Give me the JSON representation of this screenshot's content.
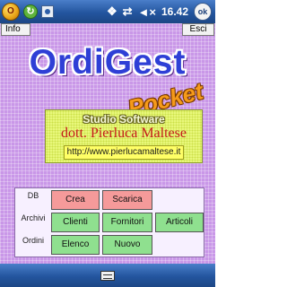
{
  "statusbar": {
    "icons": [
      "app-logo-icon",
      "sync-icon",
      "camera-icon",
      "start-windows-icon",
      "connectivity-icon",
      "volume-icon"
    ],
    "time": "16.42",
    "ok_label": "ok"
  },
  "top_buttons": {
    "info": "Info",
    "esci": "Esci"
  },
  "title": {
    "main": "OrdiGest",
    "sub": "Pocket"
  },
  "infobox": {
    "studio": "Studio Software",
    "author": "dott. Pierluca Maltese",
    "website": "http://www.pierlucamaltese.it"
  },
  "menu": {
    "labels": {
      "db": "DB",
      "archivi": "Archivi",
      "ordini": "Ordini"
    },
    "db_buttons": [
      "Crea",
      "Scarica"
    ],
    "archivi_buttons": [
      "Clienti",
      "Fornitori",
      "Articoli"
    ],
    "ordini_buttons": [
      "Elenco",
      "Nuovo"
    ]
  },
  "bottombar": {
    "icon": "keyboard-icon"
  },
  "colors": {
    "bar_blue": "#23559e",
    "background_purple": "#c997e8",
    "title_blue": "#2e3fd6",
    "pocket_orange": "#f59a1a",
    "db_button_red": "#f59a9a",
    "menu_button_green": "#8fe08f",
    "author_red": "#c41a1a"
  }
}
